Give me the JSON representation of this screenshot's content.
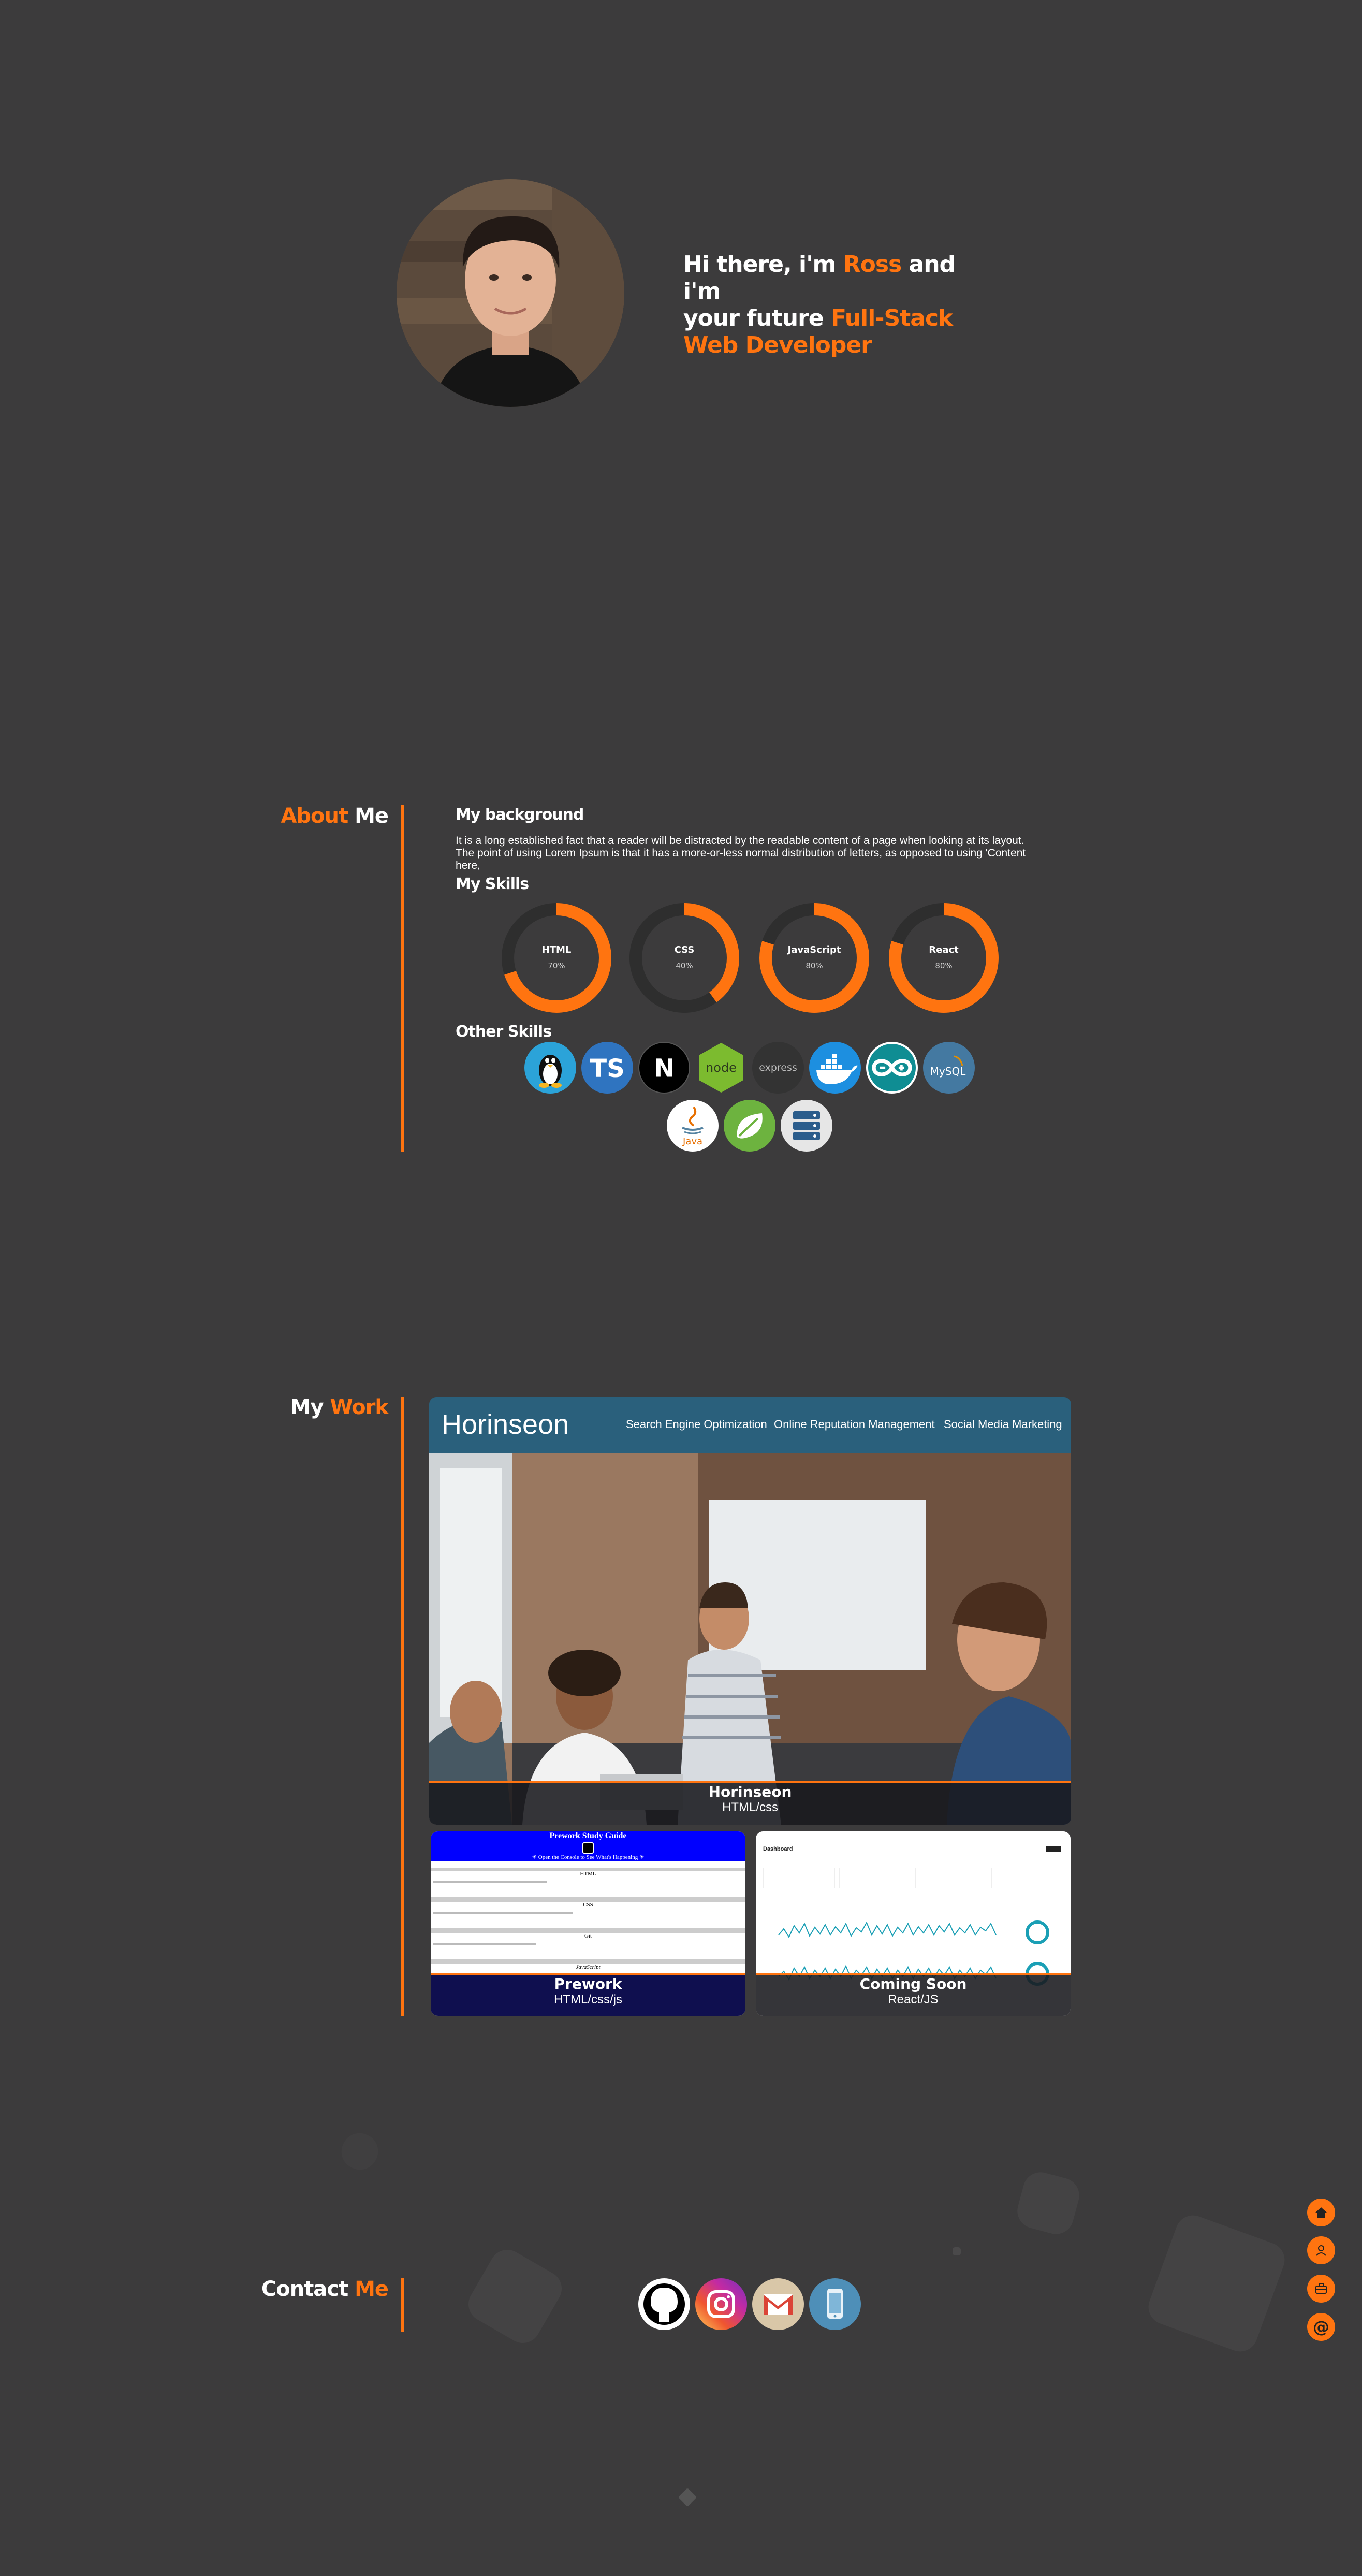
{
  "hero": {
    "line1_a": "Hi there, i'm ",
    "name": "Ross",
    "line1_b": " and i'm",
    "line2_a": "your future ",
    "role_a": "Full-Stack",
    "role_b": "Web Developer"
  },
  "about": {
    "title_a": "About",
    "title_b": " Me",
    "background_heading": "My background",
    "background_text": "It is a long established fact that a reader will be distracted by the readable content of a page when looking at its layout. The point of using Lorem Ipsum is that it has a more-or-less normal distribution of letters, as opposed to using 'Content here,",
    "skills_heading": "My Skills",
    "skills": [
      {
        "name": "HTML",
        "label": "70%",
        "value": 0.7
      },
      {
        "name": "CSS",
        "label": "40%",
        "value": 0.4
      },
      {
        "name": "JavaScript",
        "label": "80%",
        "value": 0.8
      },
      {
        "name": "React",
        "label": "80%",
        "value": 0.8
      }
    ],
    "other_heading": "Other Skills",
    "other_skills": [
      {
        "icon": "linux-icon"
      },
      {
        "icon": "typescript-icon",
        "text": "TS"
      },
      {
        "icon": "nextjs-icon",
        "text": "N"
      },
      {
        "icon": "nodejs-icon",
        "text": "node"
      },
      {
        "icon": "express-icon",
        "text": "express"
      },
      {
        "icon": "docker-icon"
      },
      {
        "icon": "arduino-icon"
      },
      {
        "icon": "mysql-icon",
        "text": "MySQL"
      },
      {
        "icon": "java-icon",
        "text": "Java"
      },
      {
        "icon": "spring-icon"
      },
      {
        "icon": "server-icon"
      }
    ]
  },
  "work": {
    "title_a": "My",
    "title_b": " Work",
    "projects": [
      {
        "title": "Horinseon",
        "tech": "HTML/css",
        "site_logo": "Horinseon",
        "site_nav": [
          "Search Engine Optimization",
          "Online Reputation Management",
          "Social Media Marketing"
        ]
      },
      {
        "title": "Prework",
        "tech": "HTML/css/js",
        "preview_heading": "Prework Study Guide",
        "preview_tip": "☀ Open the Console to See What's Happening ☀",
        "preview_sections": [
          "HTML",
          "CSS",
          "Git",
          "JavaScript"
        ]
      },
      {
        "title": "Coming Soon",
        "tech": "React/JS",
        "preview_heading": "Dashboard"
      }
    ]
  },
  "contact": {
    "title_a": "Contact",
    "title_b": " Me",
    "links": [
      {
        "icon": "github-icon"
      },
      {
        "icon": "instagram-icon"
      },
      {
        "icon": "gmail-icon"
      },
      {
        "icon": "phone-icon"
      }
    ]
  },
  "sidenav": [
    {
      "icon": "home-icon"
    },
    {
      "icon": "person-icon"
    },
    {
      "icon": "briefcase-icon"
    },
    {
      "icon": "at-icon",
      "text": "@"
    }
  ],
  "colors": {
    "accent": "#ff7410",
    "background": "#3c3b3c"
  }
}
